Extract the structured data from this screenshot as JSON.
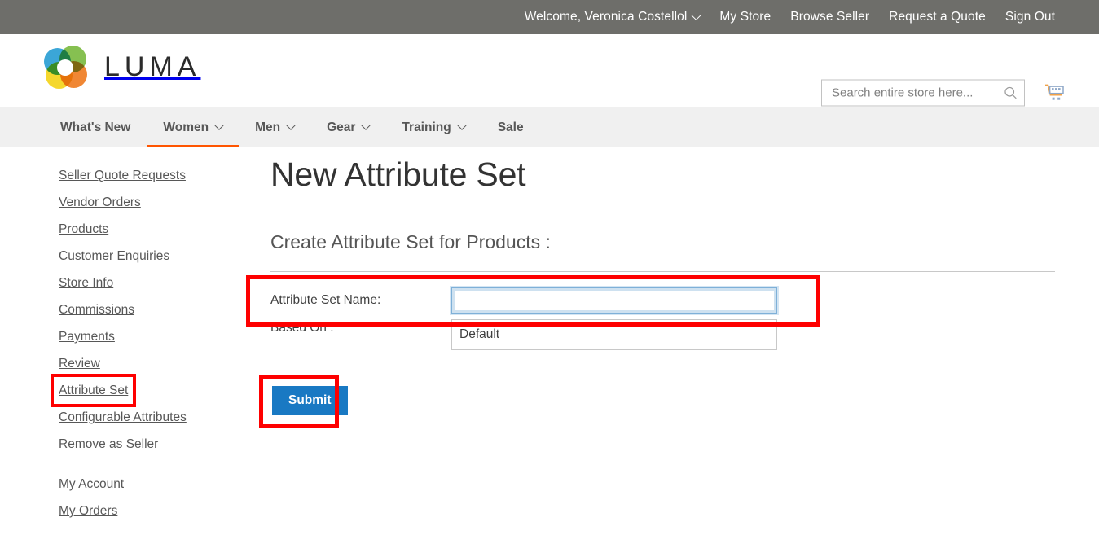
{
  "topbar": {
    "welcome": "Welcome, Veronica Costellol",
    "links": [
      "My Store",
      "Browse Seller",
      "Request a Quote",
      "Sign Out"
    ]
  },
  "header": {
    "logo_text": "LUMA",
    "logo_icon": "luma-flower-logo",
    "search": {
      "placeholder": "Search entire store here...",
      "value": "",
      "icon": "search-icon"
    },
    "cart_icon": "shopping-cart-icon"
  },
  "mainnav": {
    "items": [
      {
        "label": "What's New",
        "has_caret": false,
        "active": false
      },
      {
        "label": "Women",
        "has_caret": true,
        "active": true
      },
      {
        "label": "Men",
        "has_caret": true,
        "active": false
      },
      {
        "label": "Gear",
        "has_caret": true,
        "active": false
      },
      {
        "label": "Training",
        "has_caret": true,
        "active": false
      },
      {
        "label": "Sale",
        "has_caret": false,
        "active": false
      }
    ],
    "active_underline_color": "#ff5501"
  },
  "sidebar": {
    "items": [
      {
        "label": "Seller Quote Requests",
        "highlighted": false
      },
      {
        "label": "Vendor Orders",
        "highlighted": false
      },
      {
        "label": "Products",
        "highlighted": false
      },
      {
        "label": "Customer Enquiries",
        "highlighted": false
      },
      {
        "label": "Store Info",
        "highlighted": false
      },
      {
        "label": "Commissions",
        "highlighted": false
      },
      {
        "label": "Payments",
        "highlighted": false
      },
      {
        "label": "Review",
        "highlighted": false
      },
      {
        "label": "Attribute Set",
        "highlighted": true
      },
      {
        "label": "Configurable Attributes",
        "highlighted": false
      },
      {
        "label": "Remove as Seller",
        "highlighted": false
      }
    ],
    "account_items": [
      {
        "label": "My Account"
      },
      {
        "label": "My Orders"
      }
    ]
  },
  "main": {
    "page_title": "New Attribute Set",
    "sub_title": "Create Attribute Set for Products :",
    "form": {
      "name_label": "Attribute Set Name:",
      "name_value": "",
      "based_on_label": "Based On :",
      "based_on_value": "Default",
      "based_on_options": [
        "Default"
      ]
    },
    "submit_label": "Submit"
  },
  "colors": {
    "topbar_bg": "#6e6e6a",
    "nav_bg": "#f0f0f0",
    "accent_orange": "#ff5501",
    "submit_blue": "#1979c3",
    "highlight_red": "#fe0000",
    "focus_blue": "#7eb0d8"
  }
}
